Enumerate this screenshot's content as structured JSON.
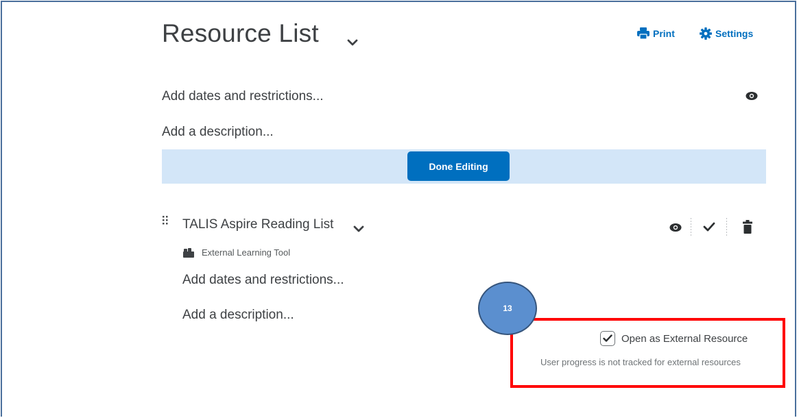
{
  "header": {
    "title": "Resource List",
    "print_label": "Print",
    "settings_label": "Settings"
  },
  "module": {
    "dates_link": "Add dates and restrictions...",
    "description_link": "Add a description...",
    "done_button": "Done Editing"
  },
  "item": {
    "title": "TALIS Aspire Reading List",
    "tool_type": "External Learning Tool",
    "dates_link": "Add dates and restrictions...",
    "description_link": "Add a description..."
  },
  "annotation": {
    "step_number": "13"
  },
  "external_option": {
    "checked": true,
    "label": "Open as External Resource",
    "note": "User progress is not tracked for external resources"
  },
  "colors": {
    "accent": "#006fbf",
    "banner": "#d3e6f8",
    "highlight": "#ff0000",
    "marker": "#5b8fcf"
  },
  "icons": [
    "chevron-down-icon",
    "printer-icon",
    "gear-icon",
    "eye-icon",
    "drag-handle-icon",
    "checkmark-icon",
    "trash-icon",
    "puzzle-icon"
  ]
}
